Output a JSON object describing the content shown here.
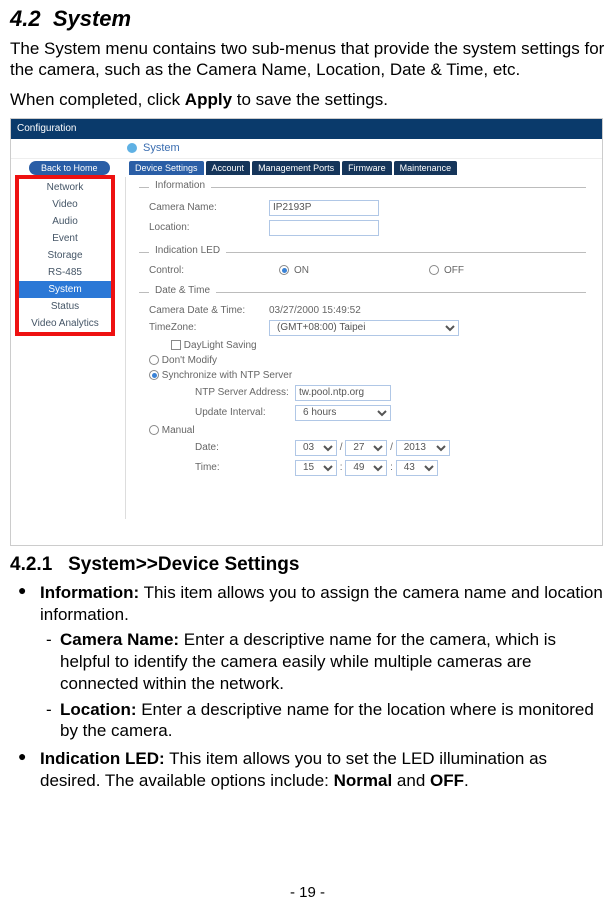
{
  "section": {
    "number": "4.2",
    "title": "System",
    "para1": "The System menu contains two sub-menus that provide the system settings for the camera, such as the Camera Name, Location, Date & Time, etc.",
    "para2_prefix": "When completed, click ",
    "para2_bold": "Apply",
    "para2_suffix": " to save the settings."
  },
  "screenshot": {
    "cfg_label": "Configuration",
    "breadcrumb": "System",
    "back_home": "Back to Home",
    "tabs": [
      "Device Settings",
      "Account",
      "Management Ports",
      "Firmware",
      "Maintenance"
    ],
    "sidebar": [
      "Network",
      "Video",
      "Audio",
      "Event",
      "Storage",
      "RS-485",
      "System",
      "Status",
      "Video Analytics"
    ],
    "information": {
      "legend": "Information",
      "camera_name_label": "Camera Name:",
      "camera_name_value": "IP2193P",
      "location_label": "Location:",
      "location_value": ""
    },
    "indication": {
      "legend": "Indication LED",
      "control_label": "Control:",
      "on": "ON",
      "off": "OFF"
    },
    "datetime": {
      "legend": "Date & Time",
      "camera_dt_label": "Camera Date & Time:",
      "camera_dt_value": "03/27/2000 15:49:52",
      "timezone_label": "TimeZone:",
      "timezone_value": "(GMT+08:00) Taipei",
      "daylight_label": "DayLight Saving",
      "dont_modify": "Don't Modify",
      "sync_ntp": "Synchronize with NTP Server",
      "ntp_addr_label": "NTP Server Address:",
      "ntp_addr_value": "tw.pool.ntp.org",
      "update_interval_label": "Update Interval:",
      "update_interval_value": "6 hours",
      "manual": "Manual",
      "date_label": "Date:",
      "date_m": "03",
      "date_d": "27",
      "date_y": "2013",
      "time_label": "Time:",
      "time_h": "15",
      "time_m": "49",
      "time_s": "43"
    }
  },
  "subsection": {
    "number": "4.2.1",
    "title": "System>>Device Settings",
    "info_bold": "Information:",
    "info_text": " This item allows you to assign the camera name and location information.",
    "camname_bold": "Camera Name:",
    "camname_text": " Enter a descriptive name for the camera, which is helpful to identify the camera easily while multiple cameras are connected within the network.",
    "location_bold": "Location:",
    "location_text": " Enter a descriptive name for the location where is monitored by the camera.",
    "led_bold": "Indication LED:",
    "led_text": " This item allows you to set the LED illumination as desired. The available options include: ",
    "led_opt1": "Normal",
    "led_and": " and ",
    "led_opt2": "OFF",
    "led_period": "."
  },
  "page_number": "- 19 -"
}
